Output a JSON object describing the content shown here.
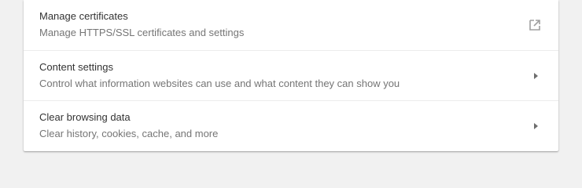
{
  "settings": {
    "items": [
      {
        "title": "Manage certificates",
        "subtitle": "Manage HTTPS/SSL certificates and settings",
        "action_icon": "open-in-new-icon"
      },
      {
        "title": "Content settings",
        "subtitle": "Control what information websites can use and what content they can show you",
        "action_icon": "arrow-right-icon"
      },
      {
        "title": "Clear browsing data",
        "subtitle": "Clear history, cookies, cache, and more",
        "action_icon": "arrow-right-icon"
      }
    ]
  }
}
